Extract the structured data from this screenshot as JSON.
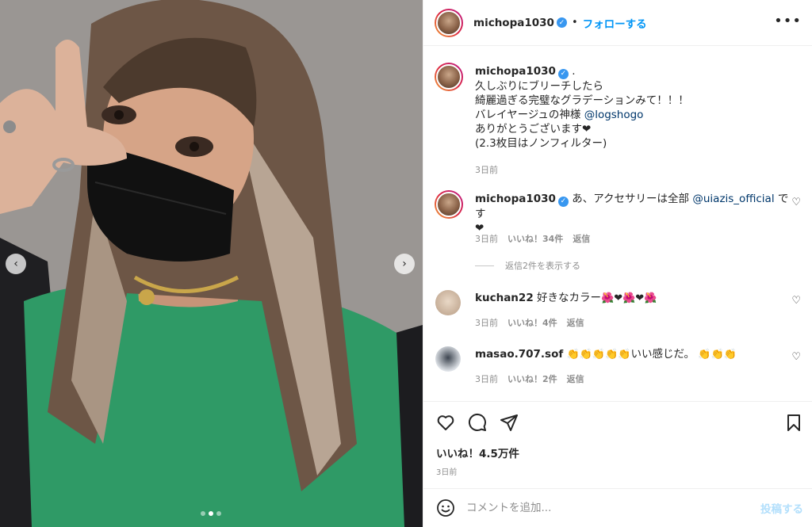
{
  "post": {
    "username": "michopa1030",
    "separator": "•",
    "follow_label": "フォローする",
    "more_label": "•••"
  },
  "carousel": {
    "prev_label": "‹",
    "next_label": "›"
  },
  "caption": {
    "username": "michopa1030",
    "lines": [
      ".",
      "久しぶりにブリーチしたら",
      "綺麗過ぎる完璧なグラデーションみて！！！",
      "バレイヤージュの神様",
      "ありがとうございます❤",
      "(2.3枚目はノンフィルター)"
    ],
    "mention": "@logshogo",
    "time": "3日前"
  },
  "comments": [
    {
      "username": "michopa1030",
      "text_before": "あ、アクセサリーは全部",
      "mention": "@uiazis_official",
      "text_after": "です",
      "second_line": "❤",
      "time": "3日前",
      "likes": "いいね！34件",
      "reply": "返信",
      "view_replies": "返信2件を表示する"
    },
    {
      "username": "kuchan22",
      "text": "好きなカラー",
      "emojis": "🌺❤🌺❤🌺",
      "time": "3日前",
      "likes": "いいね！4件",
      "reply": "返信"
    },
    {
      "username": "masao.707.sof",
      "emojis_before": "👏👏👏👏👏",
      "text": "いい感じだ。",
      "emojis_after": "👏👏👏",
      "time": "3日前",
      "likes": "いいね！2件",
      "reply": "返信"
    }
  ],
  "stats": {
    "likes": "いいね！4.5万件",
    "ago": "3日前"
  },
  "composer": {
    "placeholder": "コメントを追加...",
    "post_label": "投稿する"
  },
  "colors": {
    "accent": "#0095f6",
    "mention": "#00376b",
    "muted": "#8e8e8e",
    "post_disabled": "#b2dffc"
  }
}
